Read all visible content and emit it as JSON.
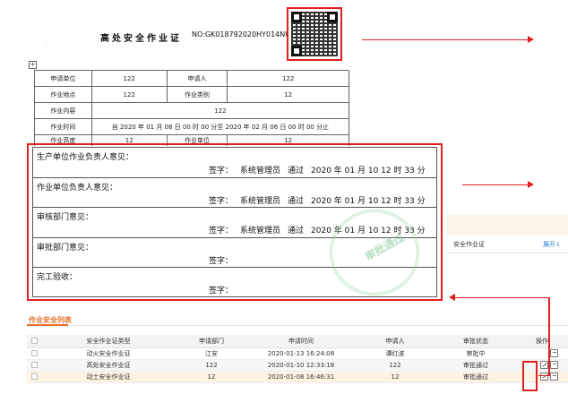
{
  "certificate": {
    "title": "高处安全作业证",
    "number": "NO:GK018792020HY014NU",
    "info_rows": [
      [
        "申请单位",
        "122",
        "申请人",
        "122"
      ],
      [
        "作业地点",
        "122",
        "作业类别",
        "12"
      ],
      [
        "作业内容",
        "122"
      ],
      [
        "作业时间",
        "自 2020 年 01 月 08 日 00 时 00 分至 2020 年 02 月 06 日 00 时 00 分止"
      ],
      [
        "作业高度",
        "12",
        "作业单位",
        "12"
      ]
    ],
    "opinions": [
      {
        "label": "生产单位作业负责人意见：",
        "sign_label": "签字：",
        "signer": "系统管理员",
        "result": "通过",
        "time": "2020 年 01 月 10 12 时 33 分"
      },
      {
        "label": "作业单位负责人意见：",
        "sign_label": "签字：",
        "signer": "系统管理员",
        "result": "通过",
        "time": "2020 年 01 月 10 12 时 33 分"
      },
      {
        "label": "审核部门意见：",
        "sign_label": "签字：",
        "signer": "系统管理员",
        "result": "通过",
        "time": "2020 年 01 月 10 12 时 33 分"
      },
      {
        "label": "审批部门意见：",
        "sign_label": "签字：",
        "signer": "",
        "result": "",
        "time": ""
      },
      {
        "label": "完工验收：",
        "sign_label": "签字：",
        "signer": "",
        "result": "",
        "time": ""
      }
    ],
    "seal_text": "审批通过"
  },
  "side_panel": {
    "title": "安全作业证",
    "expand_link": "展开↓"
  },
  "list": {
    "title": "作业安全列表",
    "columns": [
      "安全作业证类型",
      "申请部门",
      "申请时间",
      "申请人",
      "审批状态",
      "操作"
    ],
    "rows": [
      {
        "type": "动火安全作业证",
        "dept": "江安",
        "time": "2020-01-13 16:24:08",
        "applicant": "谭红波",
        "status": "审批中"
      },
      {
        "type": "高处安全作业证",
        "dept": "122",
        "time": "2020-01-10 12:33:18",
        "applicant": "122",
        "status": "审批通过"
      },
      {
        "type": "动土安全作业证",
        "dept": "12",
        "time": "2020-01-08 16:46:31",
        "applicant": "12",
        "status": "审批通过"
      }
    ]
  },
  "colors": {
    "annotation_red": "#e02020",
    "accent_orange": "#e5702c",
    "link_blue": "#2f7de1",
    "seal_green": "#7cc38d"
  }
}
